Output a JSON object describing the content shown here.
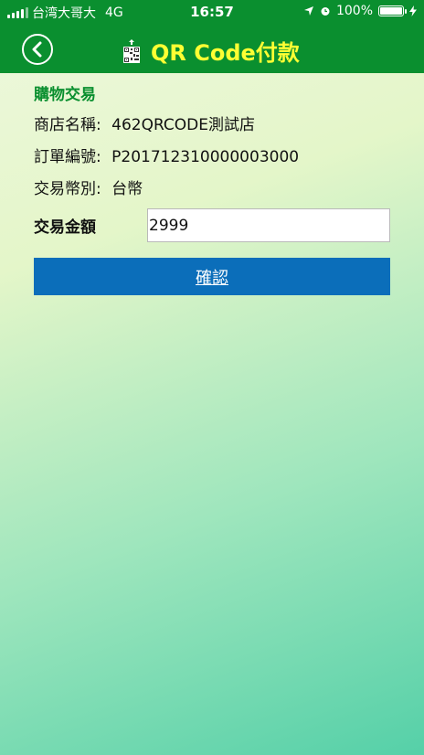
{
  "status_bar": {
    "carrier": "台湾大哥大",
    "network": "4G",
    "time": "16:57",
    "battery": "100%"
  },
  "header": {
    "back_icon": "chevron-left-circle-icon",
    "title_icon": "qr-code-icon",
    "title": "QR Code付款"
  },
  "form": {
    "section_title": "購物交易",
    "rows": [
      {
        "label": "商店名稱:",
        "value": "462QRCODE測試店"
      },
      {
        "label": "訂單編號:",
        "value": "P201712310000003000"
      },
      {
        "label": "交易幣別:",
        "value": "台幣"
      }
    ],
    "amount_label": "交易金額",
    "amount_value": "2999",
    "confirm_label": "確認"
  },
  "colors": {
    "header_bg": "#0a8f2f",
    "title_color": "#ffff33",
    "section_title": "#0a8f2f",
    "button_bg": "#0b6eba"
  }
}
